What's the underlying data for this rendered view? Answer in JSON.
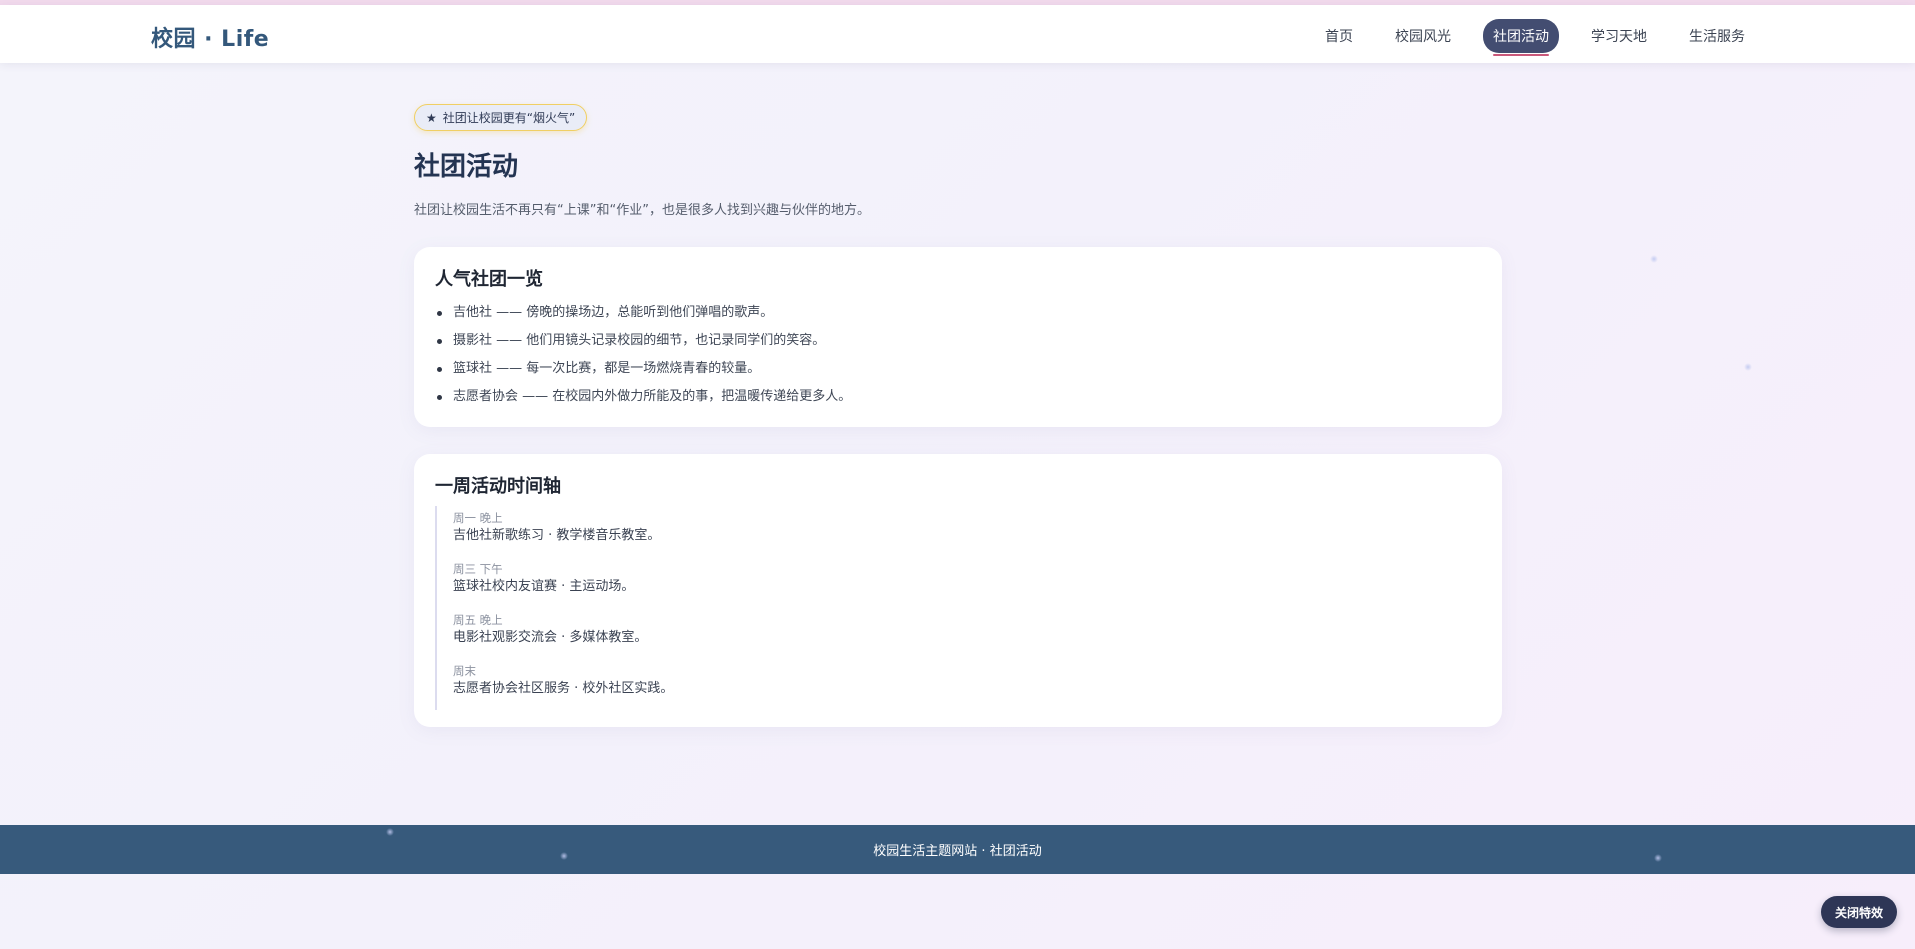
{
  "header": {
    "logo": "校园 · Life",
    "nav": [
      "首页",
      "校园风光",
      "社团活动",
      "学习天地",
      "生活服务"
    ],
    "active_nav": "社团活动"
  },
  "main": {
    "badge_icon": "star-icon",
    "badge_text": "社团让校园更有“烟火气”",
    "title": "社团活动",
    "intro": "社团让校园生活不再只有“上课”和“作业”，也是很多人找到兴趣与伙伴的地方。",
    "clubs_card": {
      "title": "人气社团一览",
      "items": [
        "吉他社 —— 傍晚的操场边，总能听到他们弹唱的歌声。",
        "摄影社 —— 他们用镜头记录校园的细节，也记录同学们的笑容。",
        "篮球社 —— 每一次比赛，都是一场燃烧青春的较量。",
        "志愿者协会 —— 在校园内外做力所能及的事，把温暖传递给更多人。"
      ]
    },
    "timeline_card": {
      "title": "一周活动时间轴",
      "items": [
        {
          "time": "周一 晚上",
          "desc": "吉他社新歌练习 · 教学楼音乐教室。"
        },
        {
          "time": "周三 下午",
          "desc": "篮球社校内友谊赛 · 主运动场。"
        },
        {
          "time": "周五 晚上",
          "desc": "电影社观影交流会 · 多媒体教室。"
        },
        {
          "time": "周末",
          "desc": "志愿者协会社区服务 · 校外社区实践。"
        }
      ]
    }
  },
  "footer": {
    "text": "校园生活主题网站 · 社团活动"
  },
  "effects_toggle": {
    "label": "关闭特效"
  },
  "colors": {
    "brand": "#34587b",
    "nav_active_bg": "#434d71",
    "footer_bg": "#375a7c",
    "badge_border": "#f0cf63"
  }
}
